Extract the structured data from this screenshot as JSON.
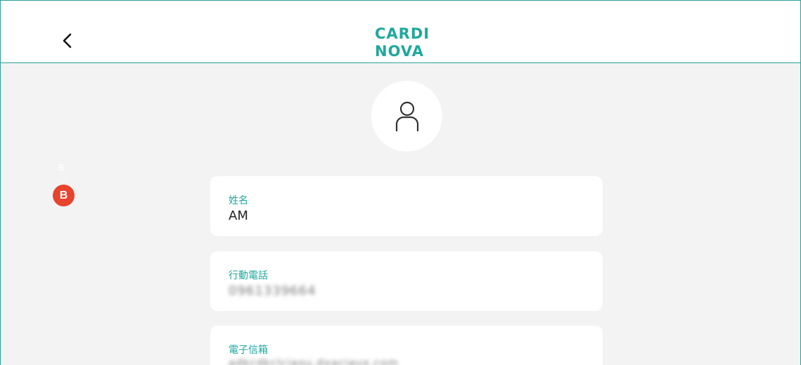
{
  "header": {
    "back_icon": "chevron-left-icon",
    "logo": {
      "line1": "CARDI",
      "line2": "NOVA",
      "color": "#1fa89e"
    }
  },
  "profile": {
    "avatar_icon": "user-icon"
  },
  "side_badges": {
    "faint_label": "B",
    "badge_label": "B",
    "badge_color": "#e8432d"
  },
  "fields": [
    {
      "label": "姓名",
      "value": "AM"
    },
    {
      "label": "行動電話",
      "value": "0961339664"
    },
    {
      "label": "電子信箱",
      "value": "adkcdkclciaou.dxaciaux.com"
    }
  ],
  "colors": {
    "accent": "#1fa89e",
    "border": "#2aa199",
    "background": "#f3f3f3"
  }
}
